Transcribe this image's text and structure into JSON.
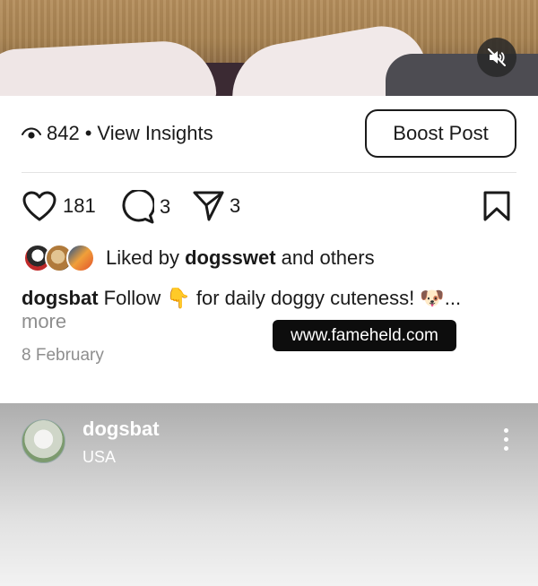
{
  "post": {
    "views_count": "842",
    "views_separator": "•",
    "insights_label": "View Insights",
    "boost_label": "Boost Post",
    "likes_count": "181",
    "comments_count": "3",
    "shares_count": "3",
    "liked_prefix": "Liked by ",
    "liked_user": "dogsswet",
    "liked_suffix": " and others",
    "caption_user": "dogsbat",
    "caption_text": " Follow 👇  for daily doggy cuteness! 🐶...",
    "more_label": "more",
    "date": "8 February"
  },
  "watermark": "www.fameheld.com",
  "next_post": {
    "username": "dogsbat",
    "location": "USA"
  },
  "icons": {
    "mute": "speaker-muted-icon",
    "views": "eye-icon",
    "like": "heart-icon",
    "comment": "comment-bubble-icon",
    "share": "paper-plane-icon",
    "save": "bookmark-icon",
    "more": "vertical-ellipsis-icon"
  }
}
